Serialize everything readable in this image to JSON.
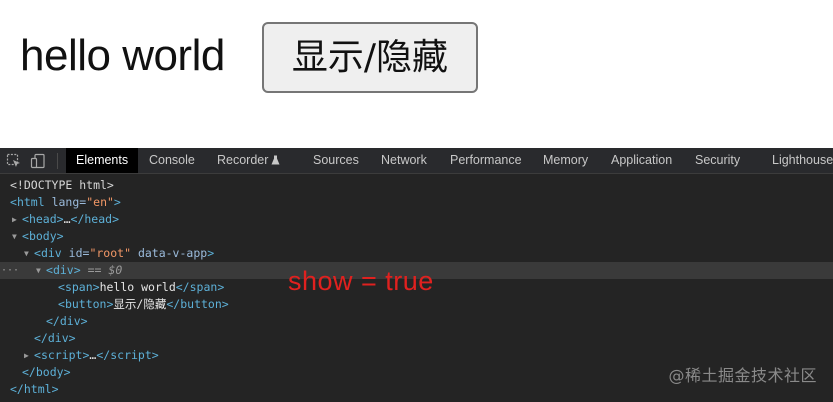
{
  "render": {
    "span_text": "hello world",
    "button_label": "显示/隐藏"
  },
  "devtools": {
    "tabs": [
      {
        "label": "Elements",
        "active": true
      },
      {
        "label": "Console",
        "active": false
      },
      {
        "label": "Recorder",
        "active": false,
        "icon": "flask-icon"
      },
      {
        "label": "Sources",
        "active": false
      },
      {
        "label": "Network",
        "active": false
      },
      {
        "label": "Performance",
        "active": false
      },
      {
        "label": "Memory",
        "active": false
      },
      {
        "label": "Application",
        "active": false
      },
      {
        "label": "Security",
        "active": false
      },
      {
        "label": "Lighthouse",
        "active": false
      }
    ],
    "toolbar_icons": [
      "inspect-element-icon",
      "device-toolbar-icon"
    ],
    "tree": {
      "doctype": "<!DOCTYPE html>",
      "html_tag": "html",
      "lang_attr": "lang",
      "lang_val": "\"en\"",
      "head_tag": "head",
      "body_tag": "body",
      "div_tag": "div",
      "id_attr": "id",
      "id_val": "\"root\"",
      "vapp_attr": "data-v-app",
      "inner_div_tag": "div",
      "selected_ref": "$0",
      "eqeq": "==",
      "span_tag": "span",
      "span_text": "hello world",
      "button_tag": "button",
      "button_text": "显示/隐藏",
      "script_tag": "script",
      "ellipsis": "…"
    }
  },
  "annotation": "show = true",
  "watermark": "@稀土掘金技术社区",
  "colors": {
    "annotation": "#e0211f",
    "tag": "#5db0d7",
    "attr_value": "#f29766"
  }
}
